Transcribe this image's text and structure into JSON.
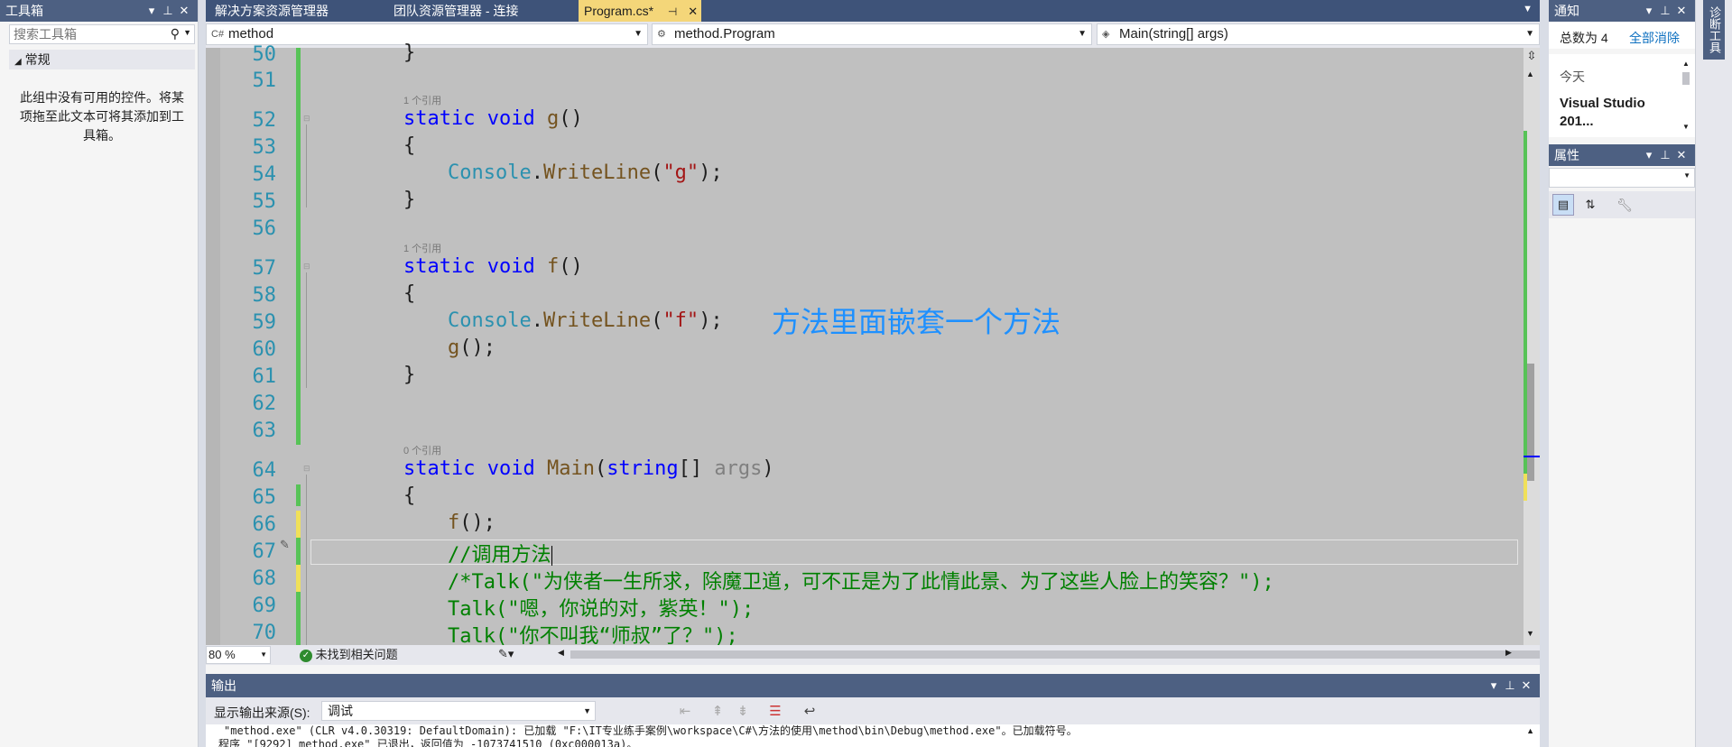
{
  "toolbox": {
    "title": "工具箱",
    "search_placeholder": "搜索工具箱",
    "group": "常规",
    "empty_text": "此组中没有可用的控件。将某项拖至此文本可将其添加到工具箱。"
  },
  "tabs": [
    {
      "label": "解决方案资源管理器"
    },
    {
      "label": "团队资源管理器 - 连接"
    },
    {
      "label": "Program.cs*"
    }
  ],
  "nav": {
    "project": "method",
    "class": "method.Program",
    "member": "Main(string[] args)"
  },
  "code": {
    "line_numbers": [
      "50",
      "51",
      "52",
      "53",
      "54",
      "55",
      "56",
      "57",
      "58",
      "59",
      "60",
      "61",
      "62",
      "63",
      "64",
      "65",
      "66",
      "67",
      "68",
      "69",
      "70"
    ],
    "lens_refs_1": "1 个引用",
    "lens_refs_0": "0 个引用",
    "l50": "}",
    "l52_kw": "static void",
    "l52_fn": "g",
    "l52_tail": "()",
    "l53": "{",
    "l54_type": "Console",
    "l54_dot": ".",
    "l54_method": "WriteLine",
    "l54_open": "(",
    "l54_str": "\"g\"",
    "l54_close": ");",
    "l55": "}",
    "l57_kw": "static void",
    "l57_fn": "f",
    "l57_tail": "()",
    "l58": "{",
    "l59_type": "Console",
    "l59_dot": ".",
    "l59_method": "WriteLine",
    "l59_open": "(",
    "l59_str": "\"f\"",
    "l59_close": ");",
    "l60_fn": "g",
    "l60_tail": "();",
    "l61": "}",
    "l64_kw": "static void",
    "l64_fn": "Main",
    "l64_open": "(",
    "l64_kw2": "string",
    "l64_brackets": "[] ",
    "l64_param": "args",
    "l64_close": ")",
    "l65": "{",
    "l66_fn": "f",
    "l66_tail": "();",
    "l67": "//调用方法",
    "l68": "/*Talk(\"为侠者一生所求，除魔卫道，可不正是为了此情此景、为了这些人脸上的笑容？\");",
    "l69": "Talk(\"嗯，你说的对，紫英！\");",
    "l70": "Talk(\"你不叫我“师叔”了？\");"
  },
  "annotation": "方法里面嵌套一个方法",
  "statusbar": {
    "zoom": "80 %",
    "issues": "未找到相关问题"
  },
  "output": {
    "title": "输出",
    "source_label": "显示输出来源(S):",
    "source_value": "调试",
    "line1": "\"method.exe\" (CLR v4.0.30319: DefaultDomain): 已加载 \"F:\\IT专业练手案例\\workspace\\C#\\方法的使用\\method\\bin\\Debug\\method.exe\"。已加载符号。",
    "line2": "程序 \"[9292] method.exe\" 已退出，返回值为 -1073741510 (0xc000013a)。"
  },
  "notifications": {
    "title": "通知",
    "total": "总数为 4",
    "clear_all": "全部消除",
    "today": "今天",
    "item": "Visual Studio 201..."
  },
  "properties": {
    "title": "属性"
  },
  "side_tab": "诊断工具",
  "colors": {
    "chrome": "#4d6082",
    "tabbar": "#3e5379",
    "active_tab": "#f4d679",
    "editor_bg": "#c0c0c0",
    "annotation": "#1e90ff",
    "saved_bar": "#57c357",
    "unsaved_bar": "#f0e05a"
  }
}
